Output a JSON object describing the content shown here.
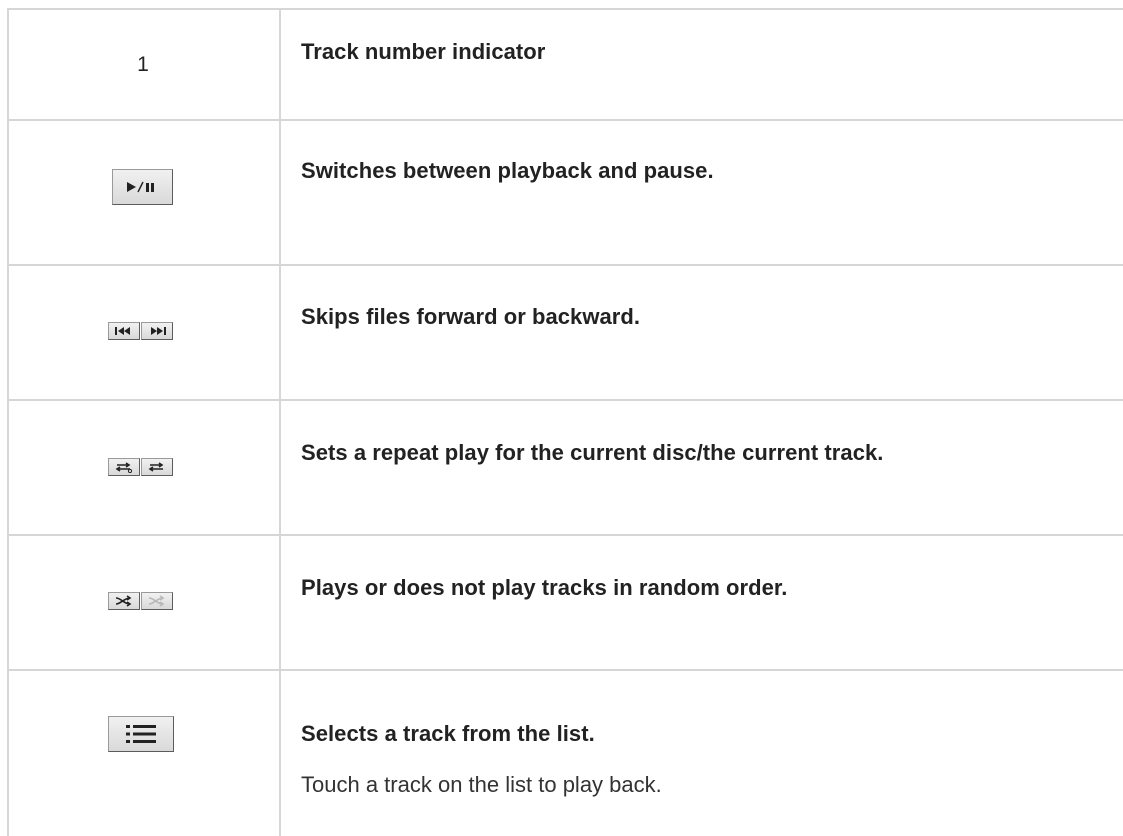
{
  "rows": [
    {
      "icon": "track-number-text",
      "icon_text": "1",
      "title": "Track number indicator"
    },
    {
      "icon": "play-pause-icon",
      "title": "Switches between playback and pause."
    },
    {
      "icon": "skip-prev-next-icons",
      "title": "Skips files forward or backward."
    },
    {
      "icon": "repeat-icons",
      "title": "Sets a repeat play for the current disc/the current track."
    },
    {
      "icon": "shuffle-icons",
      "title": "Plays or does not play tracks in random order."
    },
    {
      "icon": "list-icon",
      "title": "Selects a track from the list.",
      "note": "Touch a track on the list to play back."
    }
  ],
  "colors": {
    "border": "#d6d6d6",
    "button_bg": "#e2e2e2",
    "text": "#222222"
  }
}
